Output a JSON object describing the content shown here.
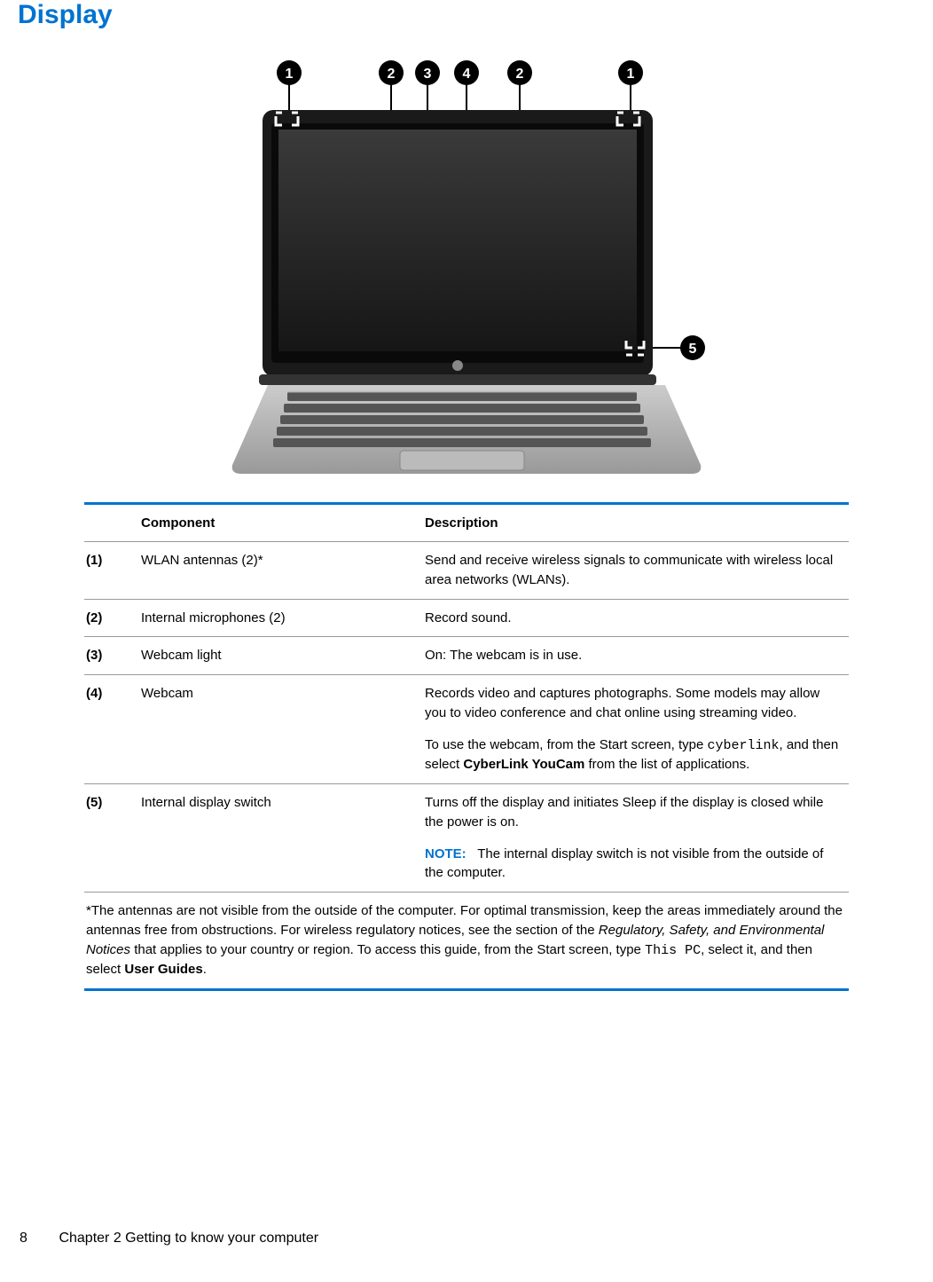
{
  "heading": "Display",
  "diagram": {
    "callouts": [
      "1",
      "2",
      "3",
      "4",
      "2",
      "1",
      "5"
    ]
  },
  "table": {
    "headers": {
      "component": "Component",
      "description": "Description"
    },
    "rows": [
      {
        "num": "(1)",
        "component": "WLAN antennas (2)*",
        "description": {
          "para1": "Send and receive wireless signals to communicate with wireless local area networks (WLANs)."
        }
      },
      {
        "num": "(2)",
        "component": "Internal microphones (2)",
        "description": {
          "para1": "Record sound."
        }
      },
      {
        "num": "(3)",
        "component": "Webcam light",
        "description": {
          "para1": "On: The webcam is in use."
        }
      },
      {
        "num": "(4)",
        "component": "Webcam",
        "description": {
          "para1": "Records video and captures photographs. Some models may allow you to video conference and chat online using streaming video.",
          "para2_pre": "To use the webcam, from the Start screen, type ",
          "para2_mono": "cyberlink",
          "para2_mid": ", and then select ",
          "para2_bold": "CyberLink YouCam",
          "para2_post": " from the list of applications."
        }
      },
      {
        "num": "(5)",
        "component": "Internal display switch",
        "description": {
          "para1": "Turns off the display and initiates Sleep if the display is closed while the power is on.",
          "note_label": "NOTE:",
          "note_text": "The internal display switch is not visible from the outside of the computer."
        }
      }
    ],
    "footnote": {
      "pre": "*The antennas are not visible from the outside of the computer. For optimal transmission, keep the areas immediately around the antennas free from obstructions. For wireless regulatory notices, see the section of the ",
      "italic": "Regulatory, Safety, and Environmental Notices",
      "mid": " that applies to your country or region. To access this guide, from the Start screen, type ",
      "mono": "This PC",
      "mid2": ", select it, and then select ",
      "bold": "User Guides",
      "post": "."
    }
  },
  "footer": {
    "page": "8",
    "chapter": "Chapter 2   Getting to know your computer"
  }
}
